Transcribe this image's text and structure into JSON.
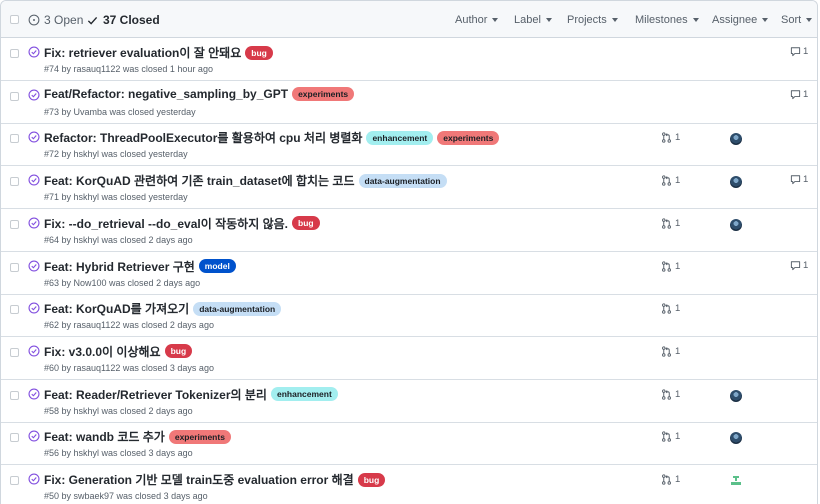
{
  "tabs": {
    "open_label": "3 Open",
    "closed_label": "37 Closed"
  },
  "filters": [
    "Author",
    "Label",
    "Projects",
    "Milestones",
    "Assignee",
    "Sort"
  ],
  "label_colors": {
    "bug": {
      "bg": "#d73a4a",
      "fg": "#ffffff"
    },
    "experiments": {
      "bg": "#f07878",
      "fg": "#1b1f24"
    },
    "enhancement": {
      "bg": "#a2eeef",
      "fg": "#1b1f24"
    },
    "data-augmentation": {
      "bg": "#c5def5",
      "fg": "#1b1f24"
    },
    "model": {
      "bg": "#0052cc",
      "fg": "#ffffff"
    }
  },
  "issues": [
    {
      "title": "Fix: retriever evaluation이 잘 안돼요",
      "labels": [
        "bug"
      ],
      "meta": "#74 by rasauq1122 was closed 1 hour ago",
      "pr": "",
      "avatar": "",
      "comments": "1"
    },
    {
      "title": "Feat/Refactor: negative_sampling_by_GPT",
      "labels": [
        "experiments"
      ],
      "meta": "#73 by Uvamba was closed yesterday",
      "pr": "",
      "avatar": "",
      "comments": "1"
    },
    {
      "title": "Refactor: ThreadPoolExecutor를 활용하여 cpu 처리 병렬화",
      "labels": [
        "enhancement",
        "experiments"
      ],
      "meta": "#72 by hskhyl was closed yesterday",
      "pr": "1",
      "avatar": "dark",
      "comments": ""
    },
    {
      "title": "Feat: KorQuAD 관련하여 기존 train_dataset에 합치는 코드",
      "labels": [
        "data-augmentation"
      ],
      "meta": "#71 by hskhyl was closed yesterday",
      "pr": "1",
      "avatar": "dark",
      "comments": "1"
    },
    {
      "title": "Fix: --do_retrieval --do_eval이 작동하지 않음.",
      "labels": [
        "bug"
      ],
      "meta": "#64 by hskhyl was closed 2 days ago",
      "pr": "1",
      "avatar": "dark",
      "comments": ""
    },
    {
      "title": "Feat: Hybrid Retriever 구현",
      "labels": [
        "model"
      ],
      "meta": "#63 by Now100 was closed 2 days ago",
      "pr": "1",
      "avatar": "",
      "comments": "1"
    },
    {
      "title": "Feat: KorQuAD를 가져오기",
      "labels": [
        "data-augmentation"
      ],
      "meta": "#62 by rasauq1122 was closed 2 days ago",
      "pr": "1",
      "avatar": "",
      "comments": ""
    },
    {
      "title": "Fix: v3.0.0이 이상해요",
      "labels": [
        "bug"
      ],
      "meta": "#60 by rasauq1122 was closed 3 days ago",
      "pr": "1",
      "avatar": "",
      "comments": ""
    },
    {
      "title": "Feat: Reader/Retriever Tokenizer의 분리",
      "labels": [
        "enhancement"
      ],
      "meta": "#58 by hskhyl was closed 2 days ago",
      "pr": "1",
      "avatar": "dark",
      "comments": ""
    },
    {
      "title": "Feat: wandb 코드 추가",
      "labels": [
        "experiments"
      ],
      "meta": "#56 by hskhyl was closed 3 days ago",
      "pr": "1",
      "avatar": "dark",
      "comments": ""
    },
    {
      "title": "Fix: Generation 기반 모델 train도중 evaluation error 해결",
      "labels": [
        "bug"
      ],
      "meta": "#50 by swbaek97 was closed 3 days ago",
      "pr": "1",
      "avatar": "green",
      "comments": ""
    }
  ]
}
